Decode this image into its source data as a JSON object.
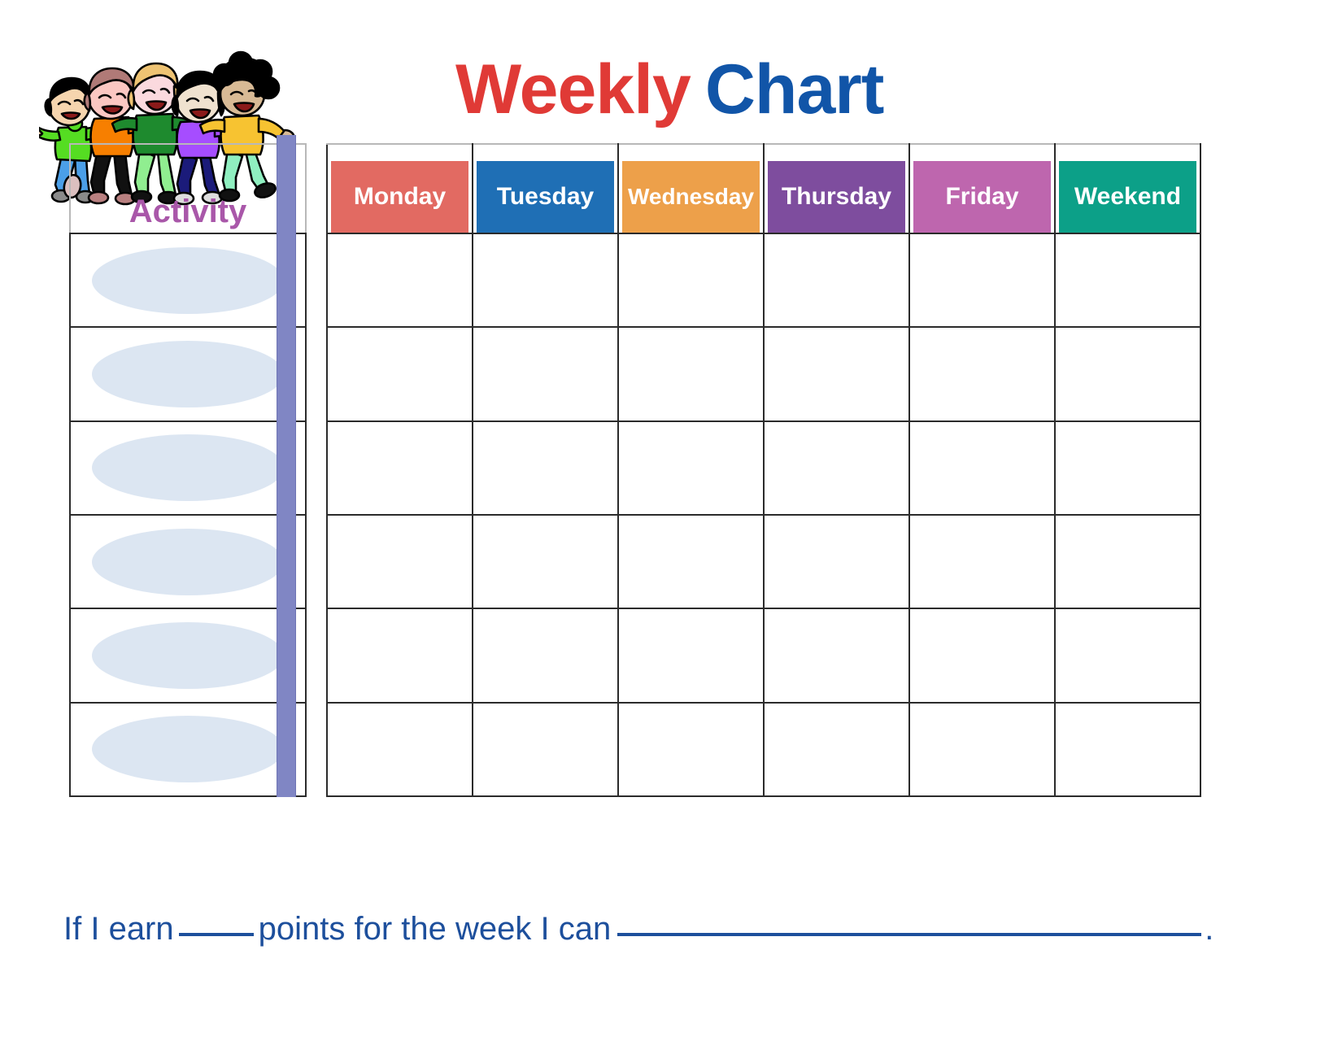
{
  "title": {
    "word1": "Weekly",
    "word2": "Chart",
    "word1_color": "#E03A36",
    "word2_color": "#1155A8"
  },
  "illustration": {
    "name": "five-children-clipart",
    "children": [
      {
        "hair": "#000000",
        "skin": "#F6D5AE",
        "shirt": "#55DD22",
        "pants": "#4B9FE8",
        "shoes": "#8A8A8A"
      },
      {
        "hair": "#B07A77",
        "skin": "#FBC7C2",
        "shirt": "#F77F00",
        "pants": "#111111",
        "shoes": "#B98080"
      },
      {
        "hair": "#EEC373",
        "skin": "#FBD9DE",
        "shirt": "#1E8A2E",
        "pants": "#90EE90",
        "shoes": "#111111"
      },
      {
        "hair": "#000000",
        "skin": "#F0E2CF",
        "shirt": "#A64DFF",
        "pants": "#1B1B7A",
        "shoes": "#DDDDDD"
      },
      {
        "hair": "#000000",
        "skin": "#D8BA95",
        "shirt": "#F7C331",
        "pants": "#8FEFC0",
        "shoes": "#111111"
      }
    ]
  },
  "table": {
    "activity_header": "Activity",
    "activity_header_color": "#A957A9",
    "divider_bar_color": "#8086C4",
    "oval_color": "#DCE6F2",
    "border_color": "#2b2b2b",
    "row_count": 6,
    "columns": [
      {
        "label": "Monday",
        "color": "#E26A62"
      },
      {
        "label": "Tuesday",
        "color": "#1F6FB5"
      },
      {
        "label": "Wednesday",
        "color": "#EDA04A"
      },
      {
        "label": "Thursday",
        "color": "#7E4D9E"
      },
      {
        "label": "Friday",
        "color": "#BE66AE"
      },
      {
        "label": "Weekend",
        "color": "#0CA088"
      }
    ],
    "rows": [
      {
        "activity": "",
        "cells": [
          "",
          "",
          "",
          "",
          "",
          ""
        ]
      },
      {
        "activity": "",
        "cells": [
          "",
          "",
          "",
          "",
          "",
          ""
        ]
      },
      {
        "activity": "",
        "cells": [
          "",
          "",
          "",
          "",
          "",
          ""
        ]
      },
      {
        "activity": "",
        "cells": [
          "",
          "",
          "",
          "",
          "",
          ""
        ]
      },
      {
        "activity": "",
        "cells": [
          "",
          "",
          "",
          "",
          "",
          ""
        ]
      },
      {
        "activity": "",
        "cells": [
          "",
          "",
          "",
          "",
          "",
          ""
        ]
      }
    ]
  },
  "footer": {
    "text_color": "#1D4F9C",
    "part1": "If I earn",
    "part2": "points for the week I can",
    "part3": "."
  }
}
